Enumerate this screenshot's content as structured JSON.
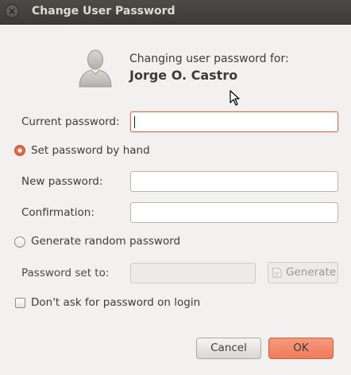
{
  "window": {
    "title": "Change User Password",
    "close_symbol": "×"
  },
  "header": {
    "label": "Changing user password for:",
    "user_name": "Jorge O. Castro",
    "avatar_icon": "user-avatar-icon"
  },
  "form": {
    "current_password_label": "Current password:",
    "current_password_value": "",
    "set_by_hand_label": "Set password by hand",
    "set_by_hand_selected": true,
    "new_password_label": "New password:",
    "new_password_value": "",
    "confirmation_label": "Confirmation:",
    "confirmation_value": "",
    "generate_random_label": "Generate random password",
    "generate_random_selected": false,
    "password_set_to_label": "Password set to:",
    "password_set_to_value": "",
    "generate_button_label": "Generate",
    "dont_ask_label": "Don't ask for password on login",
    "dont_ask_checked": false
  },
  "buttons": {
    "cancel_label": "Cancel",
    "ok_label": "OK"
  },
  "colors": {
    "accent": "#ee7b5a",
    "titlebar": "#3c3b37",
    "background": "#f2f1f0"
  }
}
